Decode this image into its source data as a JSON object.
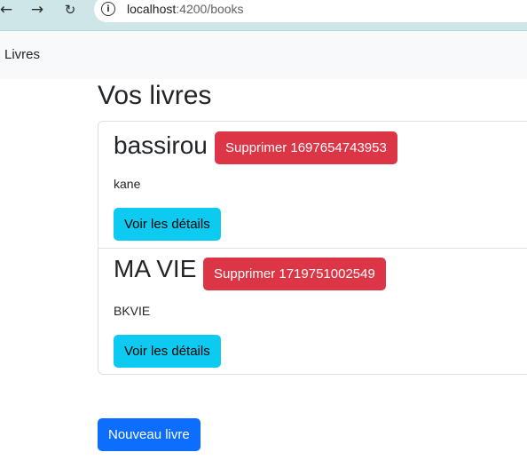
{
  "browser": {
    "url_host": "localhost",
    "url_rest": ":4200/books"
  },
  "navbar": {
    "brand": "Livres"
  },
  "main": {
    "title": "Vos livres",
    "books": [
      {
        "title": "bassirou",
        "delete_label": "Supprimer 1697654743953",
        "author": "kane",
        "details_label": "Voir les détails"
      },
      {
        "title": "MA VIE",
        "delete_label": "Supprimer 1719751002549",
        "author": "BKVIE",
        "details_label": "Voir les détails"
      }
    ],
    "new_book_label": "Nouveau livre"
  },
  "colors": {
    "danger": "#dc3545",
    "info": "#0dcaf0",
    "primary": "#0d6efd"
  }
}
